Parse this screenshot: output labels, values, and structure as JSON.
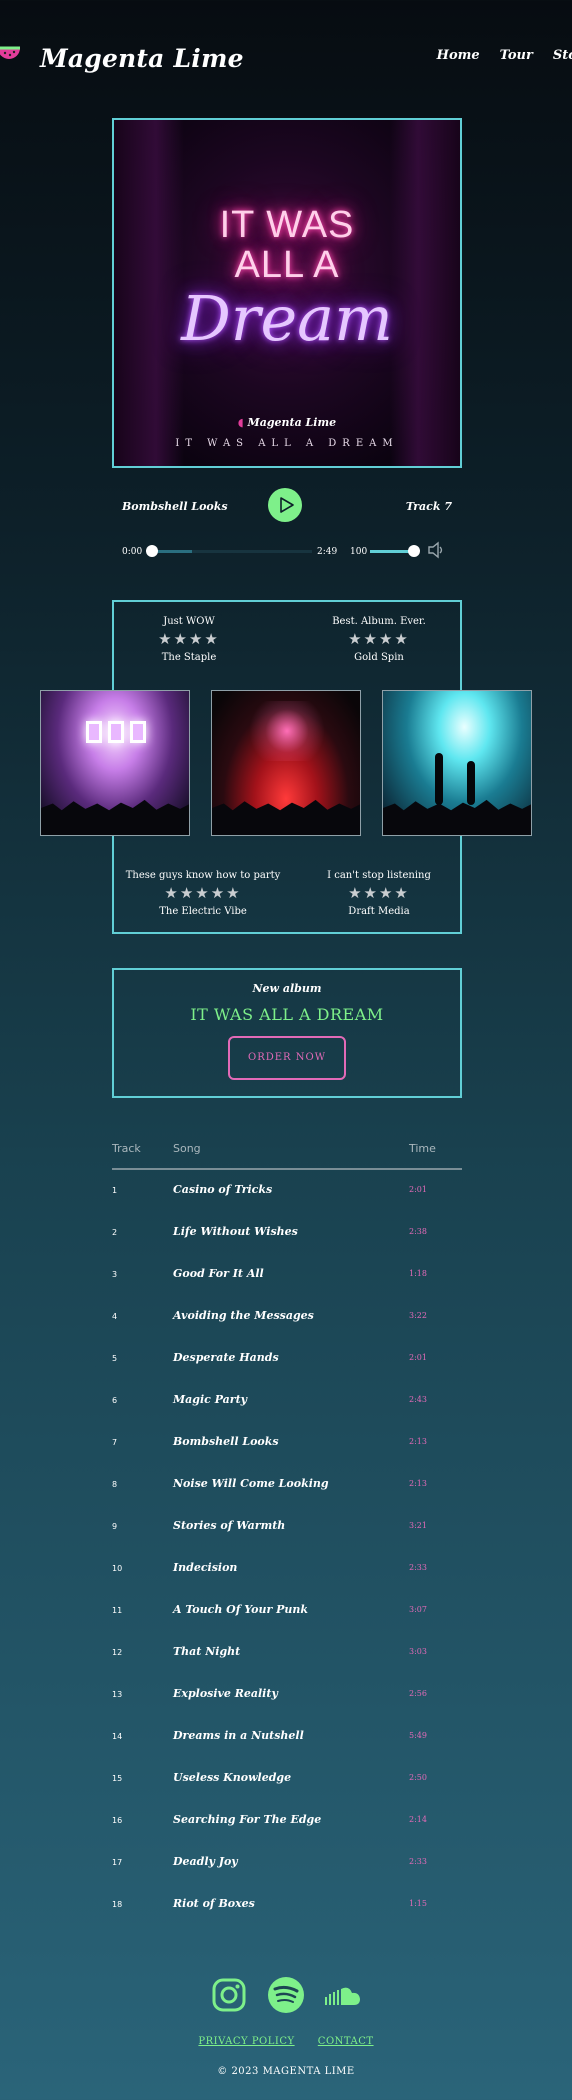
{
  "brand": {
    "name": "Magenta Lime",
    "icon": "watermelon-logo-icon"
  },
  "nav": [
    "Home",
    "Tour",
    "Store"
  ],
  "album": {
    "neon_line1": "IT WAS",
    "neon_line2": "ALL A",
    "neon_line3": "Dream",
    "brand": "Magenta Lime",
    "subtitle": "IT WAS ALL A DREAM"
  },
  "player": {
    "current_song": "Bombshell Looks",
    "track_label": "Track 7",
    "time_current": "0:00",
    "time_total": "2:49",
    "progress": 0.25,
    "volume": "100",
    "play_icon": "play-icon",
    "volume_icon": "speaker-icon"
  },
  "reviews": [
    {
      "quote": "Just WOW",
      "stars": "★★★★",
      "source": "The Staple"
    },
    {
      "quote": "Best. Album. Ever.",
      "stars": "★★★★",
      "source": "Gold Spin"
    },
    {
      "quote": "These guys know how to party",
      "stars": "★★★★★",
      "source": "The Electric Vibe"
    },
    {
      "quote": "I can't stop listening",
      "stars": "★★★★",
      "source": "Draft Media"
    }
  ],
  "promo": {
    "label": "New album",
    "title": "IT WAS ALL A DREAM",
    "button": "ORDER NOW"
  },
  "tracklist": {
    "headers": {
      "track": "Track",
      "song": "Song",
      "time": "Time"
    },
    "rows": [
      {
        "num": "1",
        "song": "Casino of Tricks",
        "time": "2:01"
      },
      {
        "num": "2",
        "song": "Life Without Wishes",
        "time": "2:38"
      },
      {
        "num": "3",
        "song": "Good For It All",
        "time": "1:18"
      },
      {
        "num": "4",
        "song": "Avoiding the Messages",
        "time": "3:22"
      },
      {
        "num": "5",
        "song": "Desperate Hands",
        "time": "2:01"
      },
      {
        "num": "6",
        "song": "Magic Party",
        "time": "2:43"
      },
      {
        "num": "7",
        "song": "Bombshell Looks",
        "time": "2:13"
      },
      {
        "num": "8",
        "song": "Noise Will Come Looking",
        "time": "2:13"
      },
      {
        "num": "9",
        "song": "Stories of Warmth",
        "time": "3:21"
      },
      {
        "num": "10",
        "song": "Indecision",
        "time": "2:33"
      },
      {
        "num": "11",
        "song": "A Touch Of Your Punk",
        "time": "3:07"
      },
      {
        "num": "12",
        "song": "That Night",
        "time": "3:03"
      },
      {
        "num": "13",
        "song": "Explosive Reality",
        "time": "2:56"
      },
      {
        "num": "14",
        "song": "Dreams in a Nutshell",
        "time": "5:49"
      },
      {
        "num": "15",
        "song": "Useless Knowledge",
        "time": "2:50"
      },
      {
        "num": "16",
        "song": "Searching For The Edge",
        "time": "2:14"
      },
      {
        "num": "17",
        "song": "Deadly Joy",
        "time": "2:33"
      },
      {
        "num": "18",
        "song": "Riot of Boxes",
        "time": "1:15"
      }
    ]
  },
  "footer": {
    "social_icons": [
      "instagram-icon",
      "spotify-icon",
      "soundcloud-icon"
    ],
    "privacy": "PRIVACY POLICY",
    "contact": "CONTACT",
    "copyright": "© 2023 MAGENTA LIME"
  },
  "colors": {
    "accent_cyan": "#61cfd6",
    "accent_lime": "#7ef08a",
    "accent_magenta": "#e26ab7"
  }
}
